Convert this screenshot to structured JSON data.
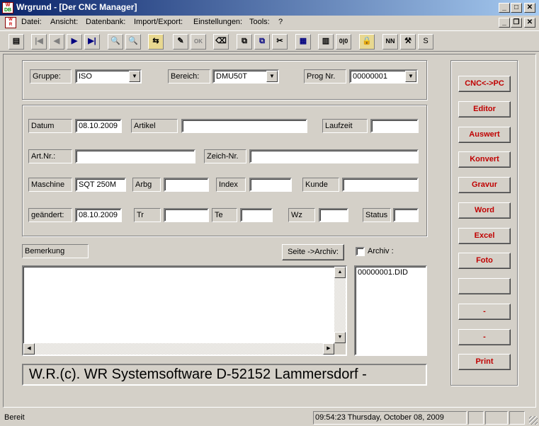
{
  "window": {
    "title": "Wrgrund - [Der CNC Manager]",
    "app_icon": "wrgrund-app-icon",
    "app_icon_text": [
      "W",
      "R",
      "DB"
    ],
    "caption_buttons": [
      "_",
      "□",
      "✕"
    ]
  },
  "menu": {
    "items": [
      "Datei:",
      "Ansicht:",
      "Datenbank:",
      "Import/Export:",
      "Einstellungen:",
      "Tools:",
      "?"
    ],
    "mdi_buttons": [
      "_",
      "❐",
      "✕"
    ]
  },
  "toolbar": {
    "buttons": [
      {
        "icon": "document-icon",
        "glyph": "▤"
      },
      {
        "icon": "first-record-icon",
        "glyph": "|◀"
      },
      {
        "icon": "previous-record-icon",
        "glyph": "◀"
      },
      {
        "icon": "next-record-icon",
        "glyph": "▶"
      },
      {
        "icon": "last-record-icon",
        "glyph": "▶|"
      },
      {
        "icon": "search-icon",
        "glyph": "🔍"
      },
      {
        "icon": "search-disabled-icon",
        "glyph": "🔍"
      },
      {
        "icon": "export-icon",
        "glyph": "⇆"
      },
      {
        "icon": "new-record-icon",
        "glyph": "✎"
      },
      {
        "icon": "ok-icon",
        "glyph": "OK"
      },
      {
        "icon": "eraser-icon",
        "glyph": "⌫"
      },
      {
        "icon": "copy-icon",
        "glyph": "⧉"
      },
      {
        "icon": "paste-icon",
        "glyph": "⧉"
      },
      {
        "icon": "cut-icon",
        "glyph": "✂"
      },
      {
        "icon": "calendar-icon",
        "glyph": "▦"
      },
      {
        "icon": "table-icon",
        "glyph": "▥"
      },
      {
        "icon": "data-icon",
        "glyph": "0|0"
      },
      {
        "icon": "lock-icon",
        "glyph": "🔒"
      },
      {
        "icon": "nn-icon",
        "glyph": "NN"
      },
      {
        "icon": "tools-icon",
        "glyph": "⚒"
      },
      {
        "icon": "s-icon",
        "glyph": "S"
      }
    ]
  },
  "header": {
    "gruppe_label": "Gruppe:",
    "gruppe_value": "ISO",
    "bereich_label": "Bereich:",
    "bereich_value": "DMU50T",
    "prog_label": "Prog Nr.",
    "prog_value": "00000001"
  },
  "details": {
    "datum_label": "Datum",
    "datum_value": "08.10.2009",
    "artikel_label": "Artikel",
    "artikel_value": "",
    "laufzeit_label": "Laufzeit",
    "laufzeit_value": "",
    "artnr_label": "Art.Nr.:",
    "artnr_value": "",
    "zeichnr_label": "Zeich-Nr.",
    "zeichnr_value": "",
    "maschine_label": "Maschine",
    "maschine_value": "SQT 250M",
    "arbg_label": "Arbg",
    "arbg_value": "",
    "index_label": "Index",
    "index_value": "",
    "kunde_label": "Kunde",
    "kunde_value": "",
    "geaendert_label": "geändert:",
    "geaendert_value": "08.10.2009",
    "tr_label": "Tr",
    "tr_value": "",
    "te_label": "Te",
    "te_value": "",
    "wz_label": "Wz",
    "wz_value": "",
    "status_label": "Status",
    "status_value": ""
  },
  "bemerkung": {
    "label": "Bemerkung",
    "text": "",
    "seite_archiv_button": "Seite ->Archiv:",
    "archiv_label": "Archiv :",
    "archiv_checked": false,
    "archive_files": [
      "00000001.DID"
    ]
  },
  "banner": "W.R.(c). WR Systemsoftware  D-52152 Lammersdorf -",
  "side_buttons": [
    "CNC<->PC",
    "Editor",
    "Auswert",
    "Konvert",
    "Gravur",
    "Word",
    "Excel",
    "Foto",
    "",
    "-",
    "-",
    "Print"
  ],
  "statusbar": {
    "text": "Bereit",
    "clock": "09:54:23 Thursday, October 08, 2009"
  },
  "colors": {
    "accent_text": "#c00000",
    "titlebar_start": "#0a246a",
    "titlebar_end": "#a6caf0",
    "face": "#d4d0c8"
  }
}
